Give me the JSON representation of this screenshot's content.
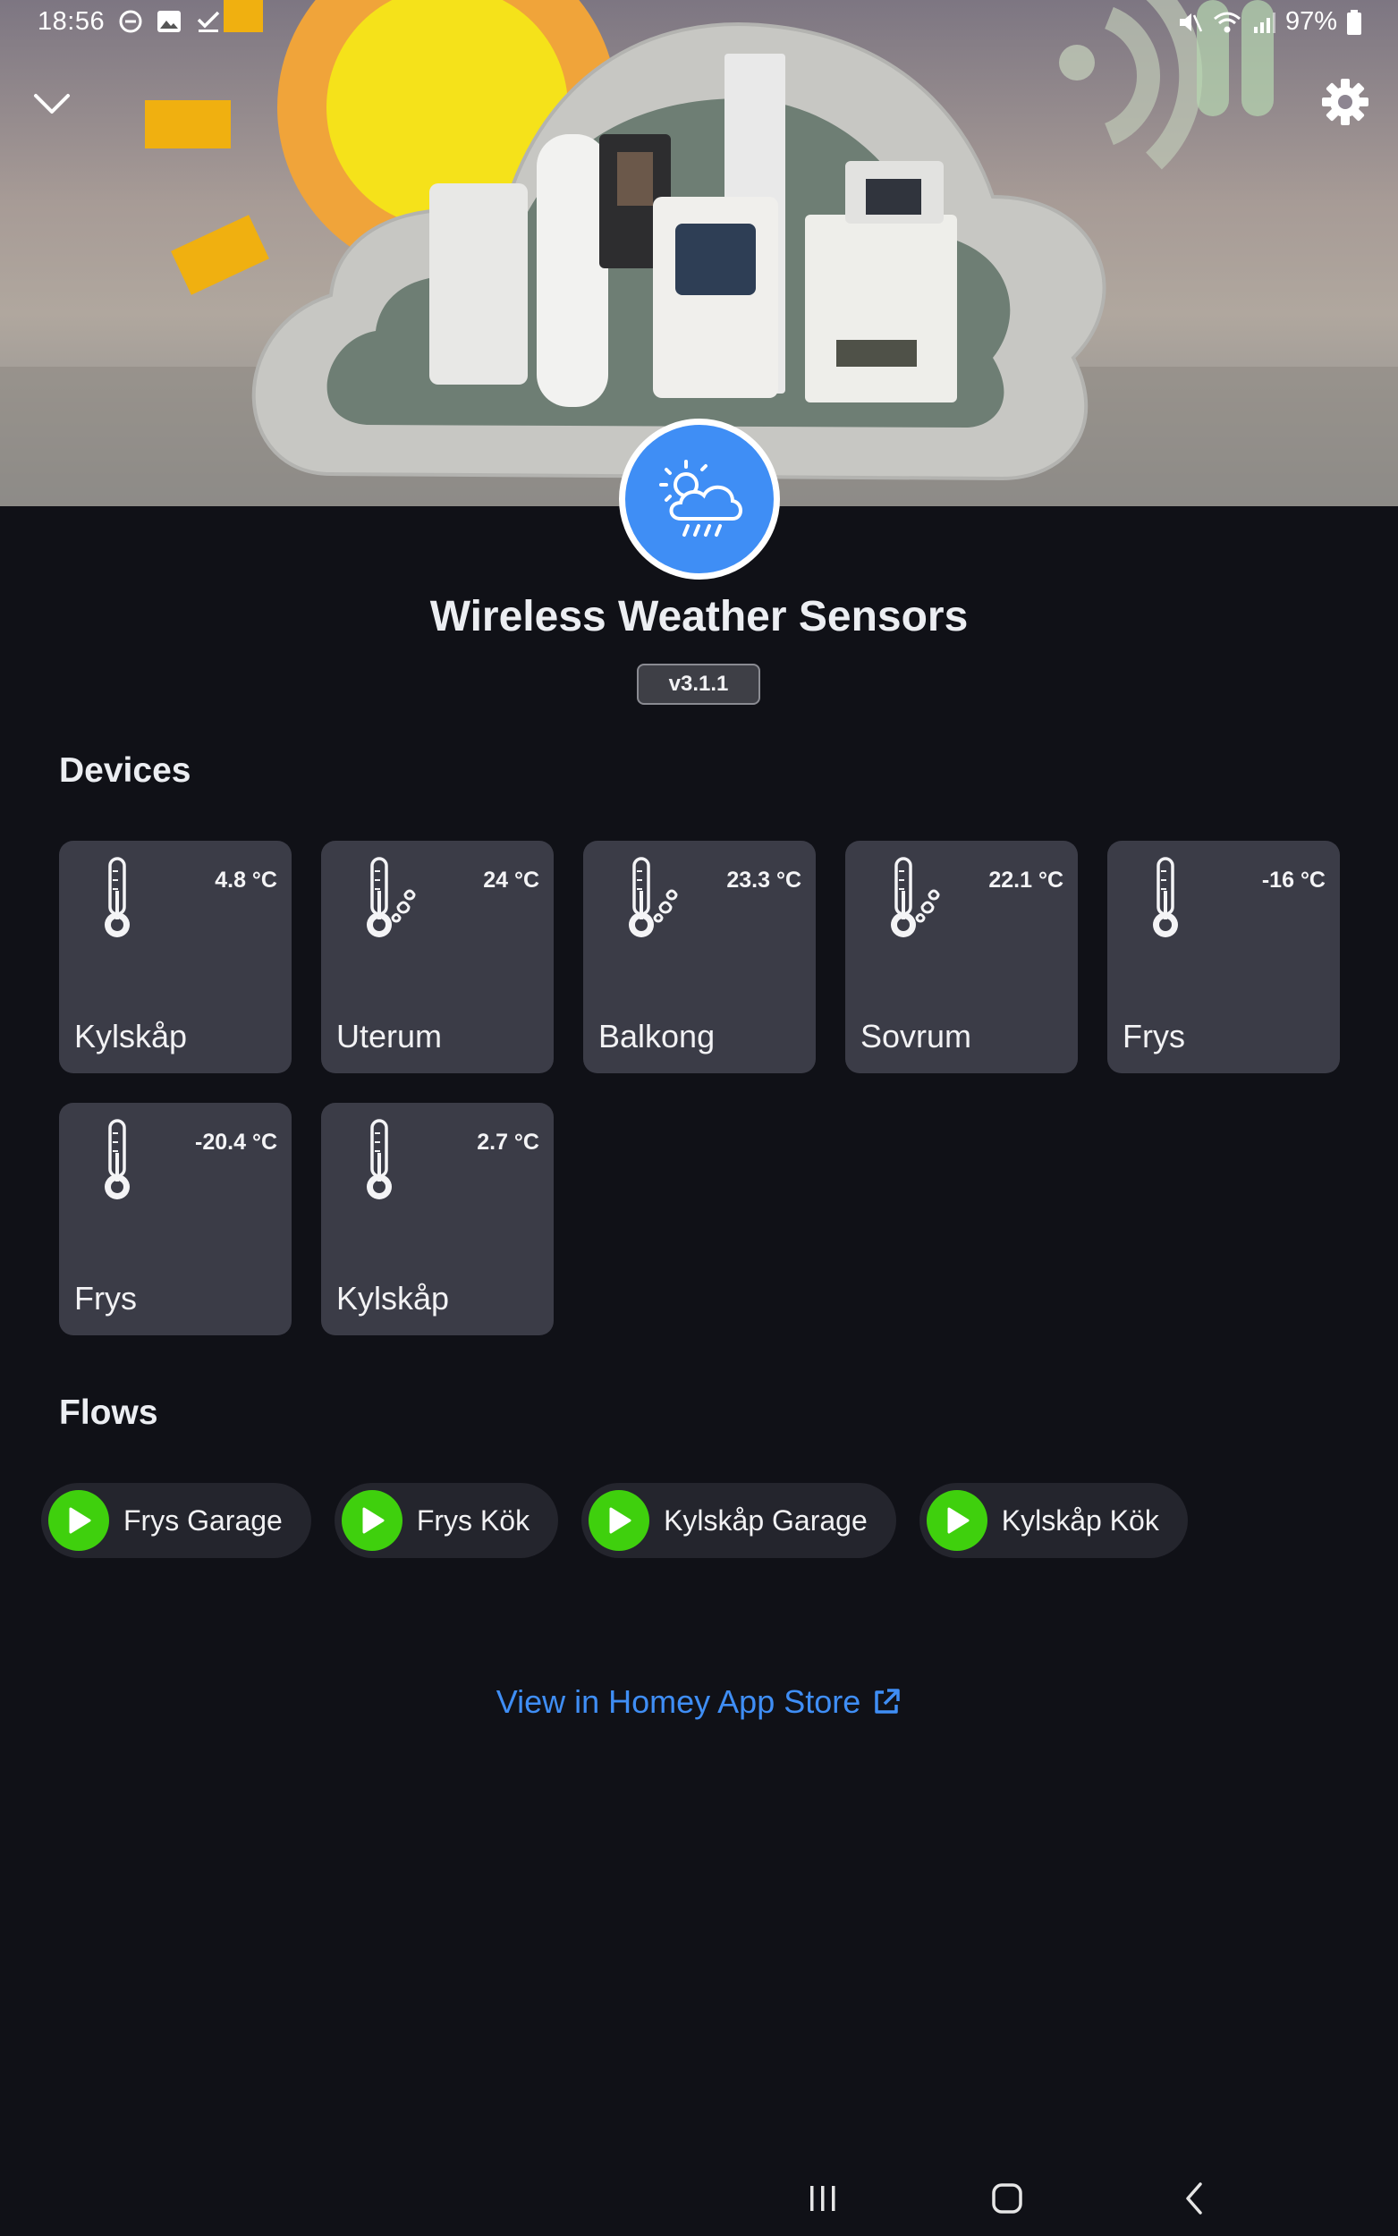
{
  "status_bar": {
    "time": "18:56",
    "battery": "97%"
  },
  "app": {
    "title": "Wireless Weather Sensors",
    "version": "v3.1.1",
    "accent_color": "#3f8ef5"
  },
  "devices": {
    "heading": "Devices",
    "items": [
      {
        "name": "Kylskåp",
        "temperature": "4.8 °C",
        "icon": "thermometer-icon"
      },
      {
        "name": "Uterum",
        "temperature": "24 °C",
        "icon": "thermometer-humidity-icon"
      },
      {
        "name": "Balkong",
        "temperature": "23.3 °C",
        "icon": "thermometer-humidity-icon"
      },
      {
        "name": "Sovrum",
        "temperature": "22.1 °C",
        "icon": "thermometer-humidity-icon"
      },
      {
        "name": "Frys",
        "temperature": "-16 °C",
        "icon": "thermometer-icon"
      },
      {
        "name": "Frys",
        "temperature": "-20.4 °C",
        "icon": "thermometer-icon"
      },
      {
        "name": "Kylskåp",
        "temperature": "2.7 °C",
        "icon": "thermometer-icon"
      }
    ]
  },
  "flows": {
    "heading": "Flows",
    "items": [
      {
        "label": "Frys Garage"
      },
      {
        "label": "Frys Kök"
      },
      {
        "label": "Kylskåp Garage"
      },
      {
        "label": "Kylskåp Kök"
      }
    ],
    "play_color": "#3fd00d"
  },
  "store_link": {
    "label": "View in Homey App Store"
  }
}
